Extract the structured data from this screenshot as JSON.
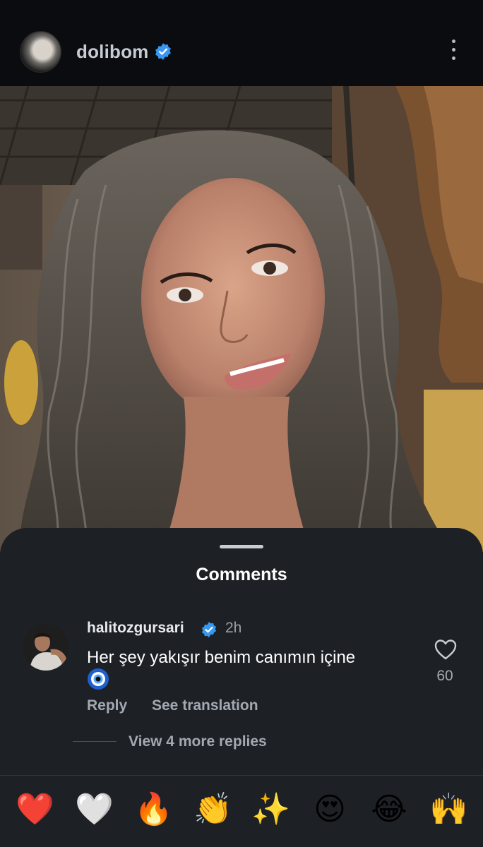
{
  "header": {
    "username": "dolibom",
    "verified_icon": "verified-badge-icon",
    "more_icon": "more-vertical-icon"
  },
  "comments": {
    "title": "Comments",
    "items": [
      {
        "username": "halitozgursari",
        "time": "2h",
        "text": "Her şey yakışır benim canımın içine",
        "emoji": "🧿",
        "reply_label": "Reply",
        "translate_label": "See translation",
        "likes": "60"
      }
    ],
    "view_replies": "View 4 more replies"
  },
  "reactions": [
    "❤️",
    "🤍",
    "🔥",
    "👏",
    "✨",
    "😍",
    "😂",
    "🙌"
  ],
  "colors": {
    "accent_blue": "#3897f0",
    "sheet_bg": "#1d2126",
    "topbar_bg": "#0a0c10"
  }
}
